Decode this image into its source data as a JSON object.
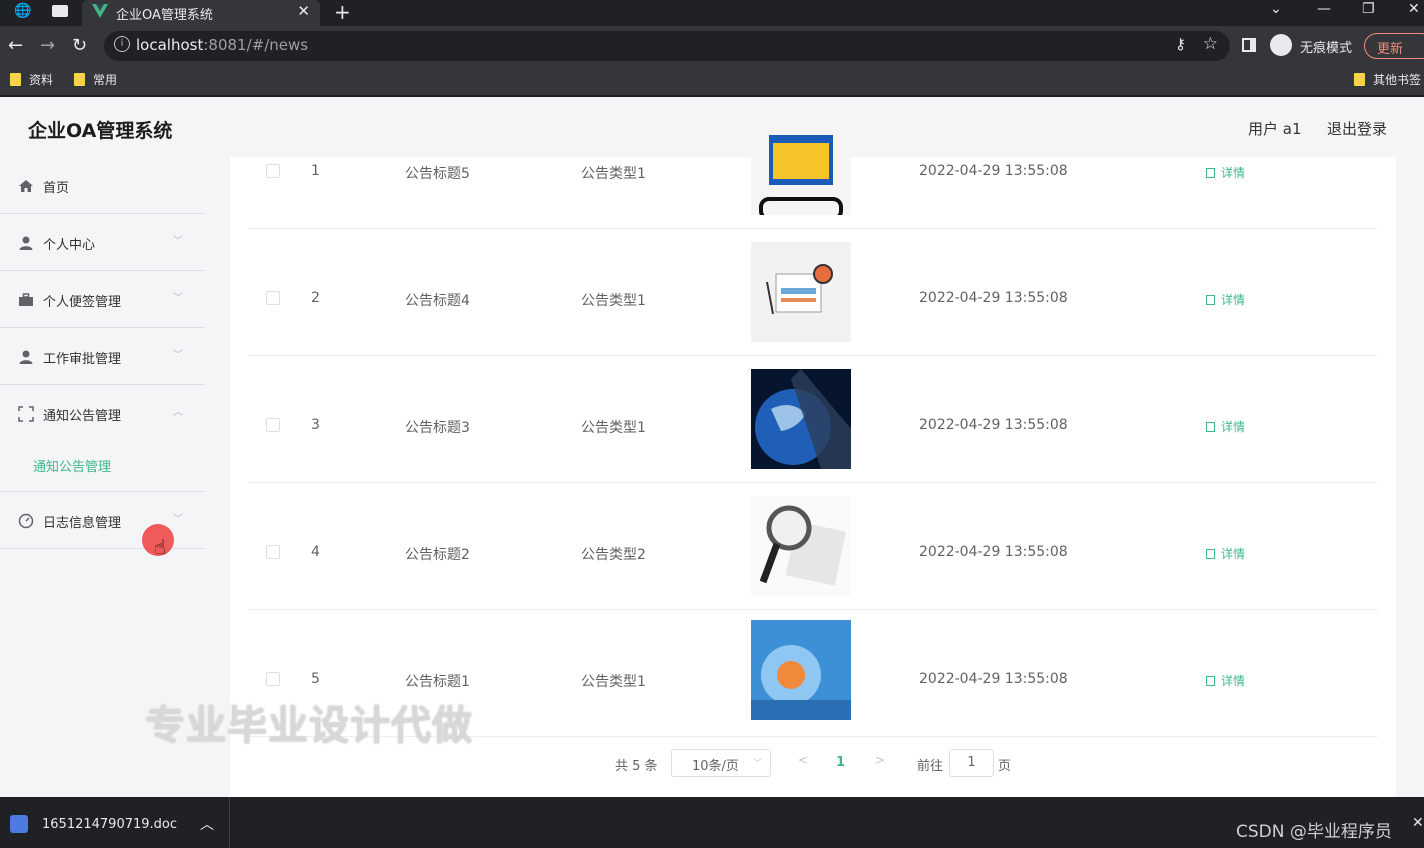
{
  "browser": {
    "tab_title": "企业OA管理系统",
    "url_host": "localhost",
    "url_rest": ":8081/#/news",
    "incognito_label": "无痕模式",
    "update_label": "更新",
    "bookmarks": [
      "资料",
      "常用"
    ],
    "other_bookmarks": "其他书签"
  },
  "header": {
    "app_title": "企业OA管理系统",
    "user_label": "用户 a1",
    "logout_label": "退出登录"
  },
  "sidebar": {
    "items": [
      {
        "label": "首页",
        "icon": "home-icon"
      },
      {
        "label": "个人中心",
        "icon": "user-icon"
      },
      {
        "label": "个人便签管理",
        "icon": "briefcase-icon"
      },
      {
        "label": "工作审批管理",
        "icon": "user-icon"
      },
      {
        "label": "通知公告管理",
        "icon": "fullscreen-icon"
      },
      {
        "label": "日志信息管理",
        "icon": "clock-icon"
      }
    ],
    "active_subitem": "通知公告管理"
  },
  "table": {
    "detail_label": "详情",
    "rows": [
      {
        "index": "1",
        "title": "公告标题5",
        "type": "公告类型1",
        "time": "2022-04-29 13:55:08"
      },
      {
        "index": "2",
        "title": "公告标题4",
        "type": "公告类型1",
        "time": "2022-04-29 13:55:08"
      },
      {
        "index": "3",
        "title": "公告标题3",
        "type": "公告类型1",
        "time": "2022-04-29 13:55:08"
      },
      {
        "index": "4",
        "title": "公告标题2",
        "type": "公告类型2",
        "time": "2022-04-29 13:55:08"
      },
      {
        "index": "5",
        "title": "公告标题1",
        "type": "公告类型1",
        "time": "2022-04-29 13:55:08"
      }
    ]
  },
  "pagination": {
    "total": "共 5 条",
    "page_size": "10条/页",
    "current_page": "1",
    "goto_label": "前往",
    "goto_value": "1",
    "goto_suffix": "页"
  },
  "overlay": {
    "watermark": "专业毕业设计代做",
    "csdn": "CSDN @毕业程序员"
  },
  "downloads": {
    "file_name": "1651214790719.doc"
  },
  "colors": {
    "accent": "#3db88a",
    "page_bg": "#f4f5f7"
  }
}
